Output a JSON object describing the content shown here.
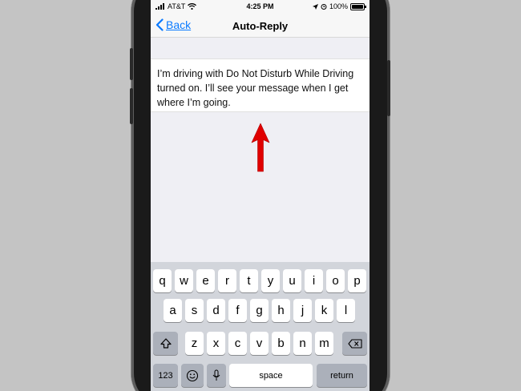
{
  "status_bar": {
    "carrier": "AT&T",
    "time": "4:25 PM",
    "battery": "100%",
    "battery_level": 1.0
  },
  "nav": {
    "back_label": "Back",
    "title": "Auto-Reply"
  },
  "auto_reply_text": "I’m driving with Do Not Disturb While Driving turned on. I’ll see your message when I get where I’m going.",
  "keyboard": {
    "row1": [
      "q",
      "w",
      "e",
      "r",
      "t",
      "y",
      "u",
      "i",
      "o",
      "p"
    ],
    "row2": [
      "a",
      "s",
      "d",
      "f",
      "g",
      "h",
      "j",
      "k",
      "l"
    ],
    "row3": [
      "z",
      "x",
      "c",
      "v",
      "b",
      "n",
      "m"
    ],
    "numbers_label": "123",
    "space_label": "space",
    "return_label": "return"
  },
  "colors": {
    "accent": "#0a7aff",
    "annotation_arrow": "#e00000",
    "keyboard_bg": "#d2d5db"
  },
  "icons": [
    "signal-icon",
    "wifi-icon",
    "location-icon",
    "alarm-icon",
    "battery-icon",
    "back-chevron-icon",
    "shift-icon",
    "backspace-icon",
    "emoji-icon",
    "microphone-icon",
    "red-arrow-icon"
  ]
}
